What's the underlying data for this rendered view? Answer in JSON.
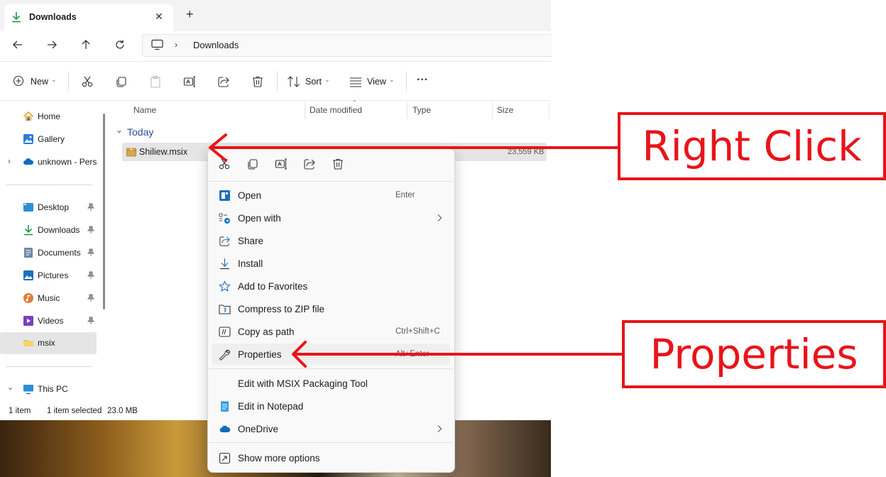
{
  "tab": {
    "title": "Downloads",
    "close": "✕",
    "new_tab": "+"
  },
  "address": {
    "path_root_icon": "monitor-icon",
    "crumb": "Downloads"
  },
  "toolbar": {
    "new_label": "New",
    "sort_label": "Sort",
    "view_label": "View",
    "more": "···"
  },
  "nav": {
    "top": [
      {
        "label": "Home"
      },
      {
        "label": "Gallery"
      },
      {
        "label": "unknown - Pers"
      }
    ],
    "quick": [
      {
        "label": "Desktop"
      },
      {
        "label": "Downloads"
      },
      {
        "label": "Documents"
      },
      {
        "label": "Pictures"
      },
      {
        "label": "Music"
      },
      {
        "label": "Videos"
      },
      {
        "label": "msix"
      }
    ],
    "this_pc": "This PC"
  },
  "columns": {
    "name": "Name",
    "date_modified": "Date modified",
    "type": "Type",
    "size": "Size"
  },
  "group": {
    "label": "Today"
  },
  "file": {
    "name": "Shiliew.msix",
    "size": "23,559 KB"
  },
  "status": {
    "count": "1 item",
    "selected": "1 item selected",
    "size": "23.0 MB"
  },
  "menu": {
    "items": [
      {
        "label": "Open",
        "accel": "Enter"
      },
      {
        "label": "Open with",
        "accel": ""
      },
      {
        "label": "Share",
        "accel": ""
      },
      {
        "label": "Install",
        "accel": ""
      },
      {
        "label": "Add to Favorites",
        "accel": ""
      },
      {
        "label": "Compress to ZIP file",
        "accel": ""
      },
      {
        "label": "Copy as path",
        "accel": "Ctrl+Shift+C"
      },
      {
        "label": "Properties",
        "accel": "Alt+Enter"
      },
      {
        "label": "Edit with MSIX Packaging Tool",
        "accel": ""
      },
      {
        "label": "Edit in Notepad",
        "accel": ""
      },
      {
        "label": "OneDrive",
        "accel": ""
      },
      {
        "label": "Show more options",
        "accel": ""
      }
    ]
  },
  "annotations": {
    "right_click": "Right Click",
    "properties": "Properties"
  },
  "colors": {
    "accent": "#0067c0",
    "annotation": "#e8141a",
    "selection": "#e5e5e5"
  }
}
